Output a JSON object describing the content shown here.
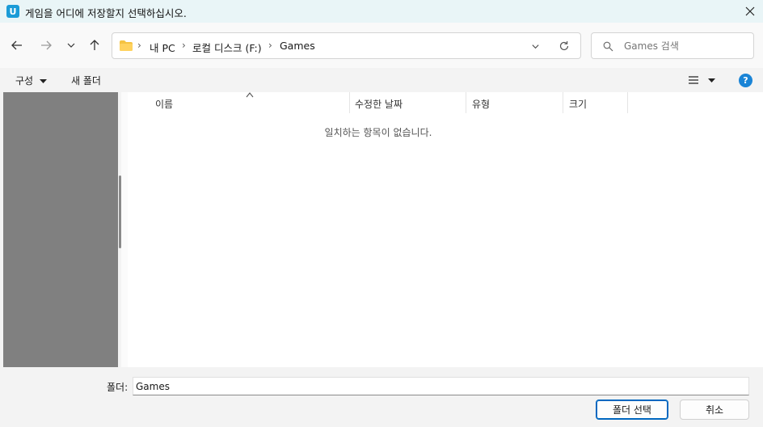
{
  "window": {
    "app_icon_letter": "U",
    "title": "게임을 어디에 저장할지 선택하십시오."
  },
  "address": {
    "crumbs": [
      "내 PC",
      "로컬 디스크 (F:)",
      "Games"
    ]
  },
  "search": {
    "placeholder": "Games 검색"
  },
  "toolbar": {
    "organize_label": "구성",
    "new_folder_label": "새 폴더",
    "help_label": "?"
  },
  "columns": {
    "name": "이름",
    "modified": "수정한 날짜",
    "type": "유형",
    "size": "크기"
  },
  "file_list": {
    "empty_message": "일치하는 항목이 없습니다."
  },
  "footer": {
    "folder_label": "폴더:",
    "folder_value": "Games",
    "select_label": "폴더 선택",
    "cancel_label": "취소"
  },
  "colors": {
    "accent": "#0067c0",
    "help_blue": "#1a84d6",
    "titlebar": "#e9f5f7",
    "nav_pane": "#808080",
    "folder_yellow": "#f5c342"
  },
  "icons": [
    "app-icon",
    "close-icon",
    "back-arrow-icon",
    "forward-arrow-icon",
    "chevron-down-icon",
    "up-arrow-icon",
    "folder-icon",
    "refresh-icon",
    "search-icon",
    "view-list-icon",
    "help-icon",
    "sort-up-icon"
  ]
}
